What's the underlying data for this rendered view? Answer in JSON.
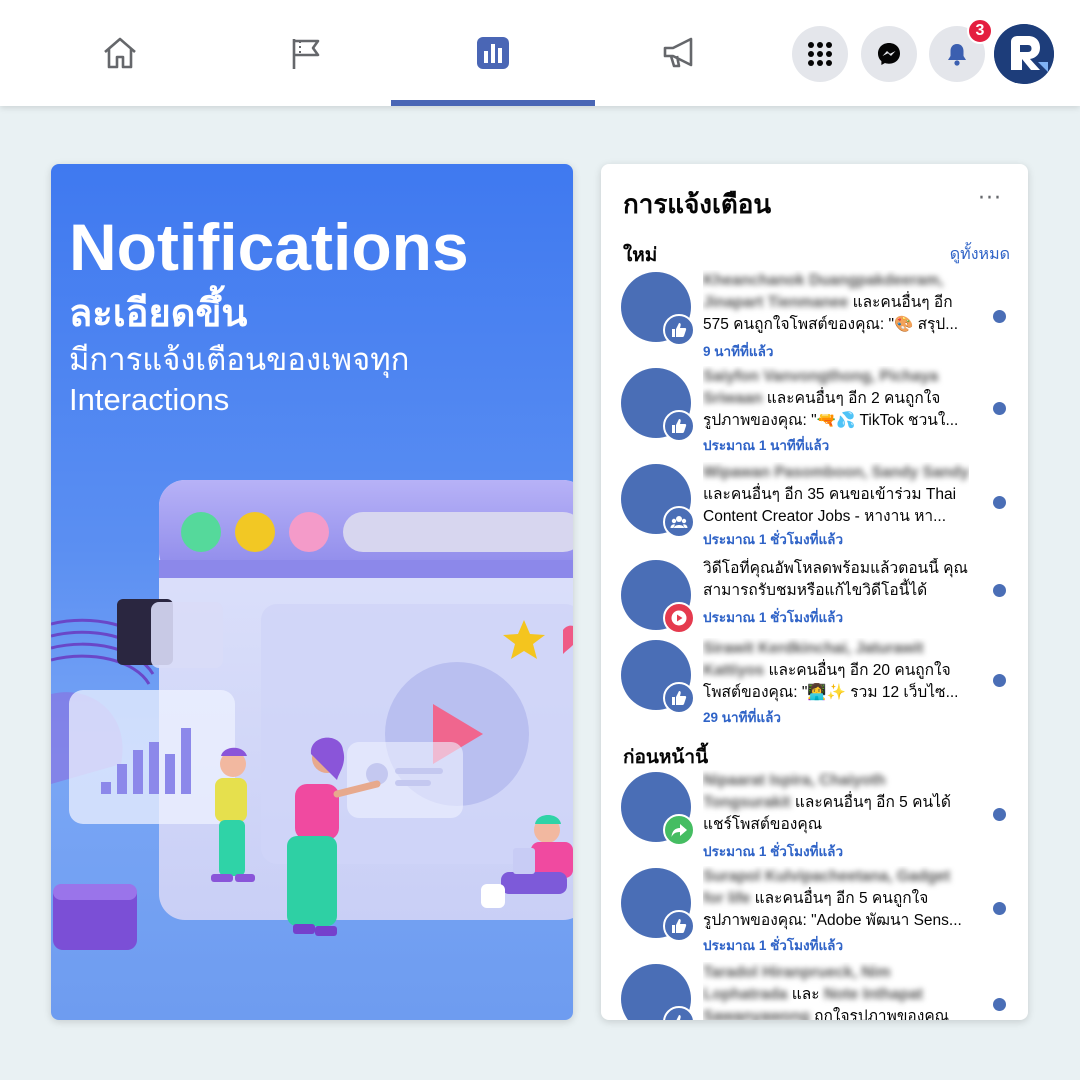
{
  "nav": {
    "tabs": [
      {
        "name": "home-icon",
        "active": false
      },
      {
        "name": "flag-icon",
        "active": false
      },
      {
        "name": "chart-icon",
        "active": true
      },
      {
        "name": "megaphone-icon",
        "active": false
      }
    ],
    "actions": [
      "menu-grid-icon",
      "messenger-icon",
      "bell-icon"
    ],
    "notification_count": "3",
    "accent_color": "#4a66b5"
  },
  "promo": {
    "title": "Notifications",
    "subtitle1": "ละเอียดขึ้น",
    "subtitle2": "มีการแจ้งเตือนของเพจทุก Interactions"
  },
  "panel": {
    "title": "การแจ้งเตือน",
    "more_label": "···",
    "section_new": "ใหม่",
    "see_all": "ดูทั้งหมด",
    "section_earlier": "ก่อนหน้านี้",
    "new_items": [
      {
        "blurred": "Kheanchanok Duangpakdeeram, Jinapart Tienmanee",
        "text": " และคนอื่นๆ อีก 575 คนถูกใจโพสต์ของคุณ: \"🎨 สรุป...",
        "time": "9 นาทีที่แล้ว",
        "icon": "like-icon"
      },
      {
        "blurred": "Saiyfon Vanvongthong, Pichaya Sriwaan",
        "text": " และคนอื่นๆ อีก 2 คนถูกใจรูปภาพของคุณ: \"🔫💦 TikTok ชวนใ...",
        "time": "ประมาณ 1 นาทีที่แล้ว",
        "icon": "like-icon"
      },
      {
        "blurred": "Wipawan Pasomboon, Sandy Sandy",
        "text": " และคนอื่นๆ อีก 35 คนขอเข้าร่วม Thai Content Creator Jobs - หางาน หา...",
        "time": "ประมาณ 1 ชั่วโมงที่แล้ว",
        "icon": "group-icon"
      },
      {
        "blurred": "",
        "text": "วิดีโอที่คุณอัพโหลดพร้อมแล้วตอนนี้ คุณสามารถรับชมหรือแก้ไขวิดีโอนี้ได้",
        "time": "ประมาณ 1 ชั่วโมงที่แล้ว",
        "icon": "video-icon"
      },
      {
        "blurred": "Sirawit Kerdkinchai, Jaturawit Kattiyos",
        "text": " และคนอื่นๆ อีก 20 คนถูกใจโพสต์ของคุณ: \"👩‍💻✨ รวม 12 เว็บไซ...",
        "time": "29 นาทีที่แล้ว",
        "icon": "like-icon"
      }
    ],
    "earlier_items": [
      {
        "blurred": "Nipaarat Ispira, Chaiyoth Tongsurakit",
        "text": " และคนอื่นๆ อีก 5 คนได้แชร์โพสต์ของคุณ",
        "time": "ประมาณ 1 ชั่วโมงที่แล้ว",
        "icon": "share-icon"
      },
      {
        "blurred": "Surapol Kulvipacheetana, Gadget for life",
        "text": " และคนอื่นๆ อีก 5 คนถูกใจรูปภาพของคุณ: \"Adobe พัฒนา Sens...",
        "time": "ประมาณ 1 ชั่วโมงที่แล้ว",
        "icon": "like-icon"
      },
      {
        "blurred": "Taradol Hiranprueck, Nim Lophatrada",
        "text": " และ ",
        "blurred2": "Note Inthapat Sawanyawong",
        "text2": " ถูกใจรูปภาพของคุณ",
        "time": "",
        "icon": "like-icon"
      }
    ]
  },
  "colors": {
    "like": "#4a6eb6",
    "group": "#4a6eb6",
    "video": "#e53a4e",
    "share": "#45bd62"
  }
}
